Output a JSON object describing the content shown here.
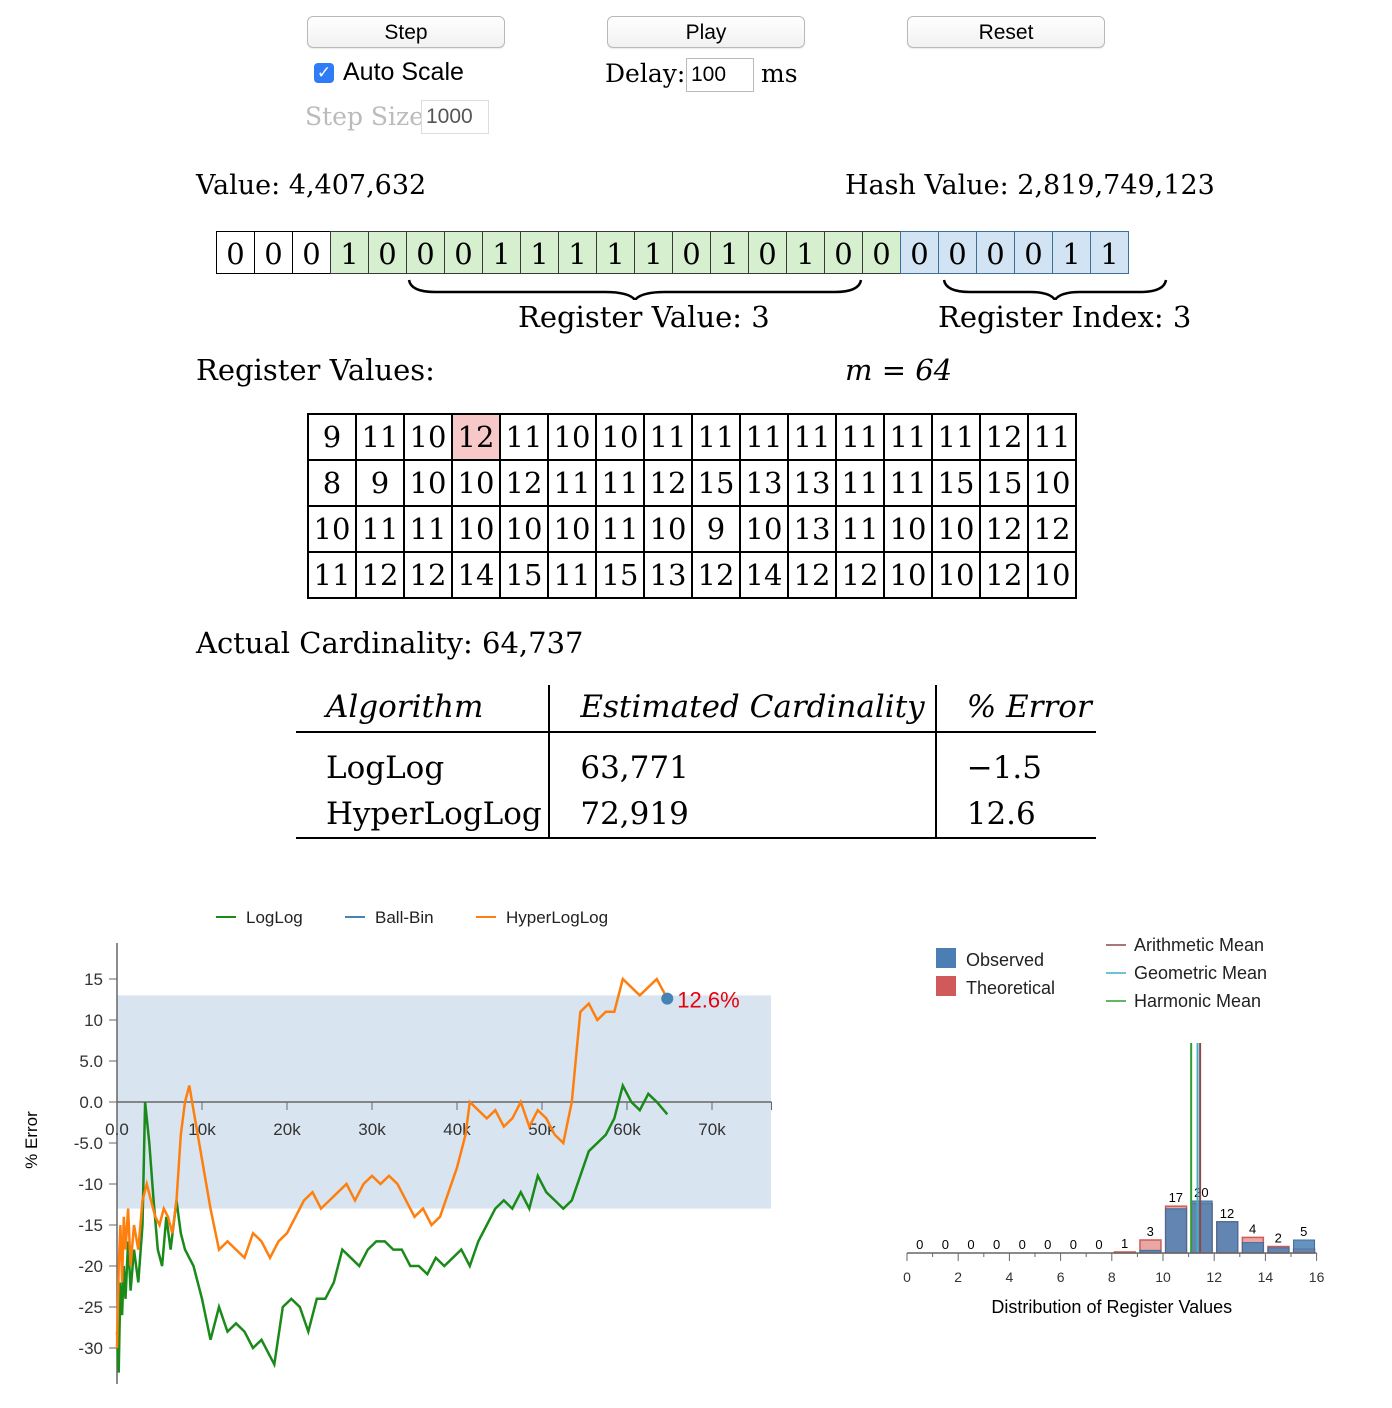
{
  "controls": {
    "step_label": "Step",
    "play_label": "Play",
    "reset_label": "Reset",
    "auto_scale_label": "Auto Scale",
    "auto_scale_checked": true,
    "delay_label": "Delay:",
    "delay_value": "100",
    "delay_unit": "ms",
    "step_size_label": "Step Size:",
    "step_size_value": "1000"
  },
  "value_label": "Value: 4,407,632",
  "hash_value_label": "Hash Value: 2,819,749,123",
  "bits": {
    "leading": [
      "0",
      "0",
      "0"
    ],
    "value_bits": [
      "1",
      "0",
      "0",
      "0",
      "1",
      "1",
      "1",
      "1",
      "1",
      "0",
      "1",
      "0",
      "1",
      "0",
      "0"
    ],
    "index_bits": [
      "0",
      "0",
      "0",
      "0",
      "1",
      "1"
    ]
  },
  "register_value_label": "Register Value: 3",
  "register_index_label": "Register Index: 3",
  "register_values_label": "Register Values:",
  "m_label": "m = 64",
  "registers": [
    [
      "9",
      "11",
      "10",
      "12",
      "11",
      "10",
      "10",
      "11",
      "11",
      "11",
      "11",
      "11",
      "11",
      "11",
      "12",
      "11"
    ],
    [
      "8",
      "9",
      "10",
      "10",
      "12",
      "11",
      "11",
      "12",
      "15",
      "13",
      "13",
      "11",
      "11",
      "15",
      "15",
      "10"
    ],
    [
      "10",
      "11",
      "11",
      "10",
      "10",
      "10",
      "11",
      "10",
      "9",
      "10",
      "13",
      "11",
      "10",
      "10",
      "12",
      "12"
    ],
    [
      "11",
      "12",
      "12",
      "14",
      "15",
      "11",
      "15",
      "13",
      "12",
      "14",
      "12",
      "12",
      "10",
      "10",
      "12",
      "10"
    ]
  ],
  "highlighted_register": 3,
  "actual_cardinality_label": "Actual Cardinality: 64,737",
  "estimates": {
    "headers": [
      "Algorithm",
      "Estimated Cardinality",
      "% Error"
    ],
    "rows": [
      [
        "LogLog",
        "63,771",
        "−1.5"
      ],
      [
        "HyperLogLog",
        "72,919",
        "12.6"
      ]
    ]
  },
  "colors": {
    "loglog": "#1a8a1a",
    "ballbin": "#4682b4",
    "hyperloglog": "#ff7f0e",
    "band": "#d8e5f0",
    "observed": "#4b7fb3",
    "theoretical": "#d05a5a",
    "highlight_register": "#f6c8c8",
    "error_label": "#e8000b"
  },
  "chart_data": [
    {
      "type": "line",
      "legend": [
        "LogLog",
        "Ball-Bin",
        "HyperLogLog"
      ],
      "ylabel": "% Error",
      "xlim": [
        0,
        77000
      ],
      "ylim": [
        -34,
        19
      ],
      "x_ticks": [
        "0.0",
        "10k",
        "20k",
        "30k",
        "40k",
        "50k",
        "60k",
        "70k"
      ],
      "y_ticks": [
        "15",
        "10",
        "5.0",
        "0.0",
        "-5.0",
        "-10",
        "-15",
        "-20",
        "-25",
        "-30"
      ],
      "band": [
        -13,
        13
      ],
      "end_label": "12.6%",
      "series": [
        {
          "name": "LogLog",
          "points": [
            [
              0,
              -28
            ],
            [
              200,
              -33
            ],
            [
              400,
              -22
            ],
            [
              600,
              -26
            ],
            [
              800,
              -20
            ],
            [
              1000,
              -24
            ],
            [
              1300,
              -17
            ],
            [
              1600,
              -23
            ],
            [
              2000,
              -18
            ],
            [
              2500,
              -22
            ],
            [
              3000,
              -15
            ],
            [
              3300,
              0
            ],
            [
              3800,
              -5
            ],
            [
              4300,
              -12
            ],
            [
              4800,
              -18
            ],
            [
              5300,
              -20
            ],
            [
              5800,
              -14
            ],
            [
              6300,
              -18
            ],
            [
              7000,
              -12
            ],
            [
              7500,
              -16
            ],
            [
              8000,
              -18
            ],
            [
              9000,
              -20
            ],
            [
              10000,
              -24
            ],
            [
              11000,
              -29
            ],
            [
              12000,
              -25
            ],
            [
              13000,
              -28
            ],
            [
              14000,
              -27
            ],
            [
              15000,
              -28
            ],
            [
              16000,
              -30
            ],
            [
              17000,
              -29
            ],
            [
              18500,
              -32
            ],
            [
              19500,
              -25
            ],
            [
              20500,
              -24
            ],
            [
              21500,
              -25
            ],
            [
              22500,
              -28
            ],
            [
              23500,
              -24
            ],
            [
              24500,
              -24
            ],
            [
              25500,
              -22
            ],
            [
              26500,
              -18
            ],
            [
              27500,
              -19
            ],
            [
              28500,
              -20
            ],
            [
              29500,
              -18
            ],
            [
              30500,
              -17
            ],
            [
              31500,
              -17
            ],
            [
              32500,
              -18
            ],
            [
              33500,
              -18
            ],
            [
              34500,
              -20
            ],
            [
              35500,
              -20
            ],
            [
              36500,
              -21
            ],
            [
              37500,
              -19
            ],
            [
              38500,
              -20
            ],
            [
              39500,
              -19
            ],
            [
              40500,
              -18
            ],
            [
              41500,
              -20
            ],
            [
              42500,
              -17
            ],
            [
              43500,
              -15
            ],
            [
              44500,
              -13
            ],
            [
              45500,
              -12
            ],
            [
              46500,
              -13
            ],
            [
              47500,
              -11
            ],
            [
              48500,
              -13
            ],
            [
              49500,
              -9
            ],
            [
              50500,
              -11
            ],
            [
              51500,
              -12
            ],
            [
              52500,
              -13
            ],
            [
              53500,
              -12
            ],
            [
              54500,
              -9
            ],
            [
              55500,
              -6
            ],
            [
              56500,
              -5
            ],
            [
              57500,
              -4
            ],
            [
              58500,
              -2
            ],
            [
              59500,
              2
            ],
            [
              60500,
              0
            ],
            [
              61500,
              -1
            ],
            [
              62500,
              1
            ],
            [
              63500,
              0
            ],
            [
              64737,
              -1.5
            ]
          ]
        },
        {
          "name": "HyperLogLog",
          "points": [
            [
              0,
              -30
            ],
            [
              200,
              -20
            ],
            [
              400,
              -15
            ],
            [
              600,
              -22
            ],
            [
              800,
              -14
            ],
            [
              1000,
              -18
            ],
            [
              1300,
              -13
            ],
            [
              1600,
              -20
            ],
            [
              2000,
              -15
            ],
            [
              2500,
              -18
            ],
            [
              3000,
              -12
            ],
            [
              3500,
              -10
            ],
            [
              4000,
              -12
            ],
            [
              4500,
              -14
            ],
            [
              5000,
              -15
            ],
            [
              5500,
              -13
            ],
            [
              6000,
              -14
            ],
            [
              6500,
              -16
            ],
            [
              7000,
              -12
            ],
            [
              7500,
              -4
            ],
            [
              8000,
              0
            ],
            [
              8500,
              2
            ],
            [
              9000,
              -1
            ],
            [
              10000,
              -7
            ],
            [
              11000,
              -13
            ],
            [
              12000,
              -18
            ],
            [
              13000,
              -17
            ],
            [
              14000,
              -18
            ],
            [
              15000,
              -19
            ],
            [
              16000,
              -16
            ],
            [
              17000,
              -17
            ],
            [
              18000,
              -19
            ],
            [
              19000,
              -17
            ],
            [
              20000,
              -16
            ],
            [
              21000,
              -14
            ],
            [
              22000,
              -12
            ],
            [
              23000,
              -11
            ],
            [
              24000,
              -13
            ],
            [
              25000,
              -12
            ],
            [
              26000,
              -11
            ],
            [
              27000,
              -10
            ],
            [
              28000,
              -12
            ],
            [
              29000,
              -10
            ],
            [
              30000,
              -9
            ],
            [
              31000,
              -10
            ],
            [
              32000,
              -9
            ],
            [
              33000,
              -10
            ],
            [
              34000,
              -12
            ],
            [
              35000,
              -14
            ],
            [
              36000,
              -13
            ],
            [
              37000,
              -15
            ],
            [
              38000,
              -14
            ],
            [
              39000,
              -11
            ],
            [
              40000,
              -8
            ],
            [
              41000,
              -4
            ],
            [
              41500,
              0
            ],
            [
              42500,
              -1
            ],
            [
              43500,
              -2
            ],
            [
              44500,
              -1
            ],
            [
              45500,
              -3
            ],
            [
              46500,
              -2
            ],
            [
              47500,
              0
            ],
            [
              48500,
              -3
            ],
            [
              49500,
              -1
            ],
            [
              50500,
              -2
            ],
            [
              51500,
              -4
            ],
            [
              52500,
              -5
            ],
            [
              53500,
              0
            ],
            [
              54500,
              11
            ],
            [
              55500,
              12
            ],
            [
              56500,
              10
            ],
            [
              57500,
              11
            ],
            [
              58500,
              11
            ],
            [
              59500,
              15
            ],
            [
              60500,
              14
            ],
            [
              61500,
              13
            ],
            [
              62500,
              14
            ],
            [
              63500,
              15
            ],
            [
              64737,
              12.6
            ]
          ]
        }
      ]
    },
    {
      "type": "bar",
      "legend": [
        "Observed",
        "Theoretical"
      ],
      "line_legend": [
        "Arithmetic Mean",
        "Geometric Mean",
        "Harmonic Mean"
      ],
      "xlabel": "Distribution of Register Values",
      "x_ticks": [
        "0",
        "2",
        "4",
        "6",
        "8",
        "10",
        "12",
        "14",
        "16"
      ],
      "xlim": [
        0,
        16
      ],
      "categories": [
        0,
        1,
        2,
        3,
        4,
        5,
        6,
        7,
        8,
        9,
        10,
        11,
        12,
        13,
        14,
        15
      ],
      "observed": [
        0,
        0,
        0,
        0,
        0,
        0,
        0,
        0,
        0,
        1,
        17,
        20,
        12,
        4,
        2,
        5
      ],
      "theoretical": [
        0,
        0,
        0,
        0,
        0,
        0,
        0,
        0,
        0.4,
        5,
        18,
        19,
        12,
        6,
        2.5,
        1.5
      ],
      "bar_labels": [
        "0",
        "0",
        "0",
        "0",
        "0",
        "0",
        "0",
        "0",
        "1",
        "3",
        "17",
        "20",
        "12",
        "4",
        "2",
        "5"
      ],
      "means": {
        "arithmetic": 11.45,
        "geometric": 11.35,
        "harmonic": 11.1
      }
    }
  ]
}
